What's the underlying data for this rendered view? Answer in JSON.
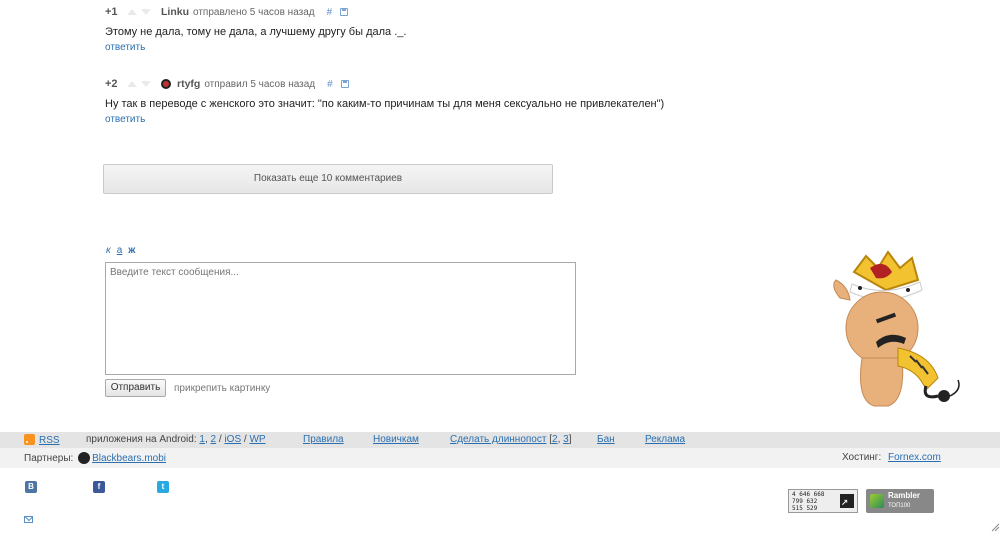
{
  "comments": [
    {
      "rating": "+1",
      "author": "Linku",
      "meta": "отправлено 5 часов назад",
      "anchor": "#",
      "text": "Этому не дала, тому не дала, а лучшему другу бы дала ._.",
      "reply": "ответить"
    },
    {
      "rating": "+2",
      "author": "rtyfg",
      "meta": "отправил 5 часов назад",
      "anchor": "#",
      "text": "Ну так в переводе с женского это значит: \"по каким-то причинам ты для меня сексуально не привлекателен\")",
      "reply": "ответить"
    }
  ],
  "more_button": "Показать еще 10 комментариев",
  "format": {
    "italic": "к",
    "underline": "а",
    "bold": "ж"
  },
  "editor": {
    "placeholder": "Введите текст сообщения...",
    "send": "Отправить",
    "attach": "прикрепить картинку"
  },
  "footer": {
    "rss": "RSS",
    "android_label": "приложения на Android:",
    "android_1": "1",
    "android_2": "2",
    "sep1": "/",
    "ios": "iOS",
    "sep2": "/",
    "wp": "WP",
    "rules": "Правила",
    "newbies": "Новичкам",
    "longpost": "Сделать длиннопост",
    "longpost_bracket_open": "[",
    "longpost_2": "2",
    "longpost_comma": ",",
    "longpost_3": "3",
    "longpost_bracket_close": "]",
    "ban": "Бан",
    "ads": "Реклама",
    "partners_label": "Партнеры:",
    "partner": "Blackbears.mobi",
    "hosting_label": "Хостинг:",
    "hosting": "Fornex.com"
  },
  "social": {
    "vk": "B",
    "fb": "f",
    "tw": "t"
  },
  "counter": {
    "line1": "4 646 668",
    "line2": "799 632",
    "line3": "515 529"
  },
  "rambler": {
    "title": "Rambler",
    "sub": "ТОП100"
  },
  "icons": [
    "up-arrow-icon",
    "down-arrow-icon",
    "save-icon",
    "rss-icon",
    "vk-icon",
    "facebook-icon",
    "twitter-icon",
    "mail-icon"
  ]
}
